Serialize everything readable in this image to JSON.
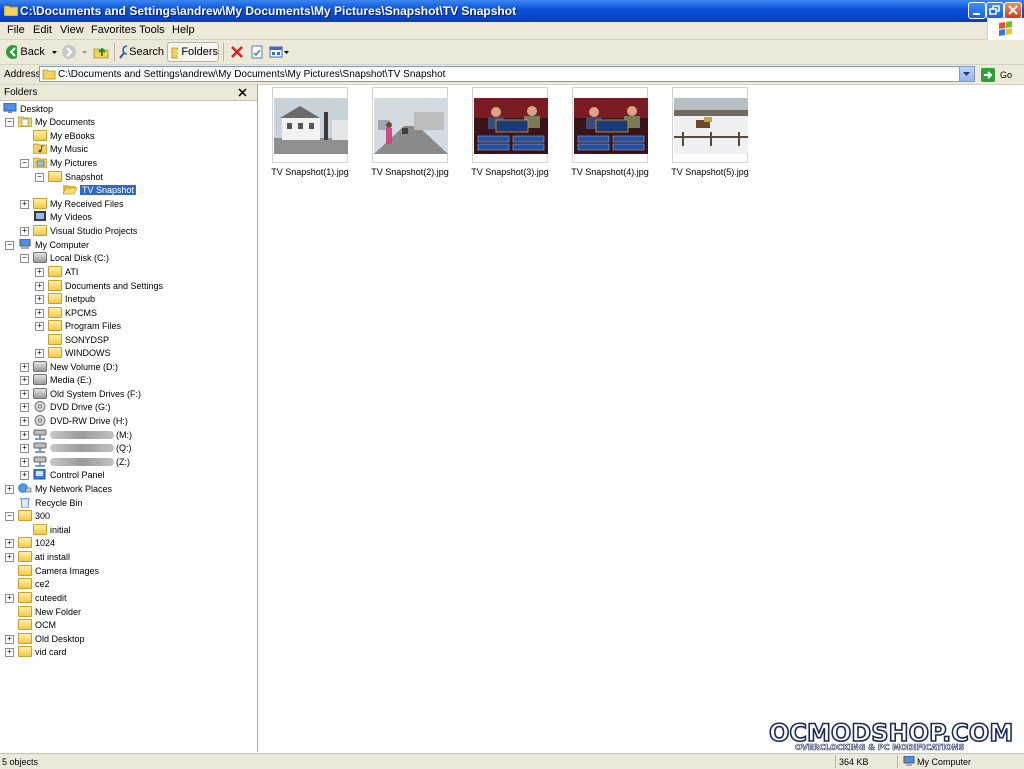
{
  "window": {
    "title": "C:\\Documents and Settings\\andrew\\My Documents\\My Pictures\\Snapshot\\TV Snapshot"
  },
  "menu": {
    "items": [
      "File",
      "Edit",
      "View",
      "Favorites",
      "Tools",
      "Help"
    ]
  },
  "toolbar": {
    "back_label": "Back",
    "search_label": "Search",
    "folders_label": "Folders"
  },
  "address": {
    "label": "Address",
    "value": "C:\\Documents and Settings\\andrew\\My Documents\\My Pictures\\Snapshot\\TV Snapshot",
    "go_label": "Go"
  },
  "folders_pane": {
    "title": "Folders",
    "tree": [
      {
        "label": "Desktop"
      },
      {
        "label": "My Documents"
      },
      {
        "label": "My eBooks"
      },
      {
        "label": "My Music"
      },
      {
        "label": "My Pictures"
      },
      {
        "label": "Snapshot"
      },
      {
        "label": "TV Snapshot"
      },
      {
        "label": "My Received Files"
      },
      {
        "label": "My Videos"
      },
      {
        "label": "Visual Studio Projects"
      },
      {
        "label": "My Computer"
      },
      {
        "label": "Local Disk (C:)"
      },
      {
        "label": "ATI"
      },
      {
        "label": "Documents and Settings"
      },
      {
        "label": "Inetpub"
      },
      {
        "label": "KPCMS"
      },
      {
        "label": "Program Files"
      },
      {
        "label": "SONYDSP"
      },
      {
        "label": "WINDOWS"
      },
      {
        "label": "New Volume (D:)"
      },
      {
        "label": "Media (E:)"
      },
      {
        "label": "Old System Drives (F:)"
      },
      {
        "label": "DVD Drive (G:)"
      },
      {
        "label": "DVD-RW Drive (H:)"
      },
      {
        "label": "(M:)"
      },
      {
        "label": "(Q:)"
      },
      {
        "label": "(Z:)"
      },
      {
        "label": "Control Panel"
      },
      {
        "label": "My Network Places"
      },
      {
        "label": "Recycle Bin"
      },
      {
        "label": "300"
      },
      {
        "label": "initial"
      },
      {
        "label": "1024"
      },
      {
        "label": "ati install"
      },
      {
        "label": "Camera Images"
      },
      {
        "label": "ce2"
      },
      {
        "label": "cuteedit"
      },
      {
        "label": "New Folder"
      },
      {
        "label": "OCM"
      },
      {
        "label": "Old Desktop"
      },
      {
        "label": "vid card"
      }
    ]
  },
  "files": [
    {
      "name": "TV Snapshot(1).jpg"
    },
    {
      "name": "TV Snapshot(2).jpg"
    },
    {
      "name": "TV Snapshot(3).jpg"
    },
    {
      "name": "TV Snapshot(4).jpg"
    },
    {
      "name": "TV Snapshot(5).jpg"
    }
  ],
  "watermark": {
    "text": "OCMODSHOP.COM",
    "subtext": "OVERCLOCKING & PC MODIFICATIONS"
  },
  "status": {
    "objects": "5 objects",
    "size": "364 KB",
    "zone": "My Computer"
  }
}
